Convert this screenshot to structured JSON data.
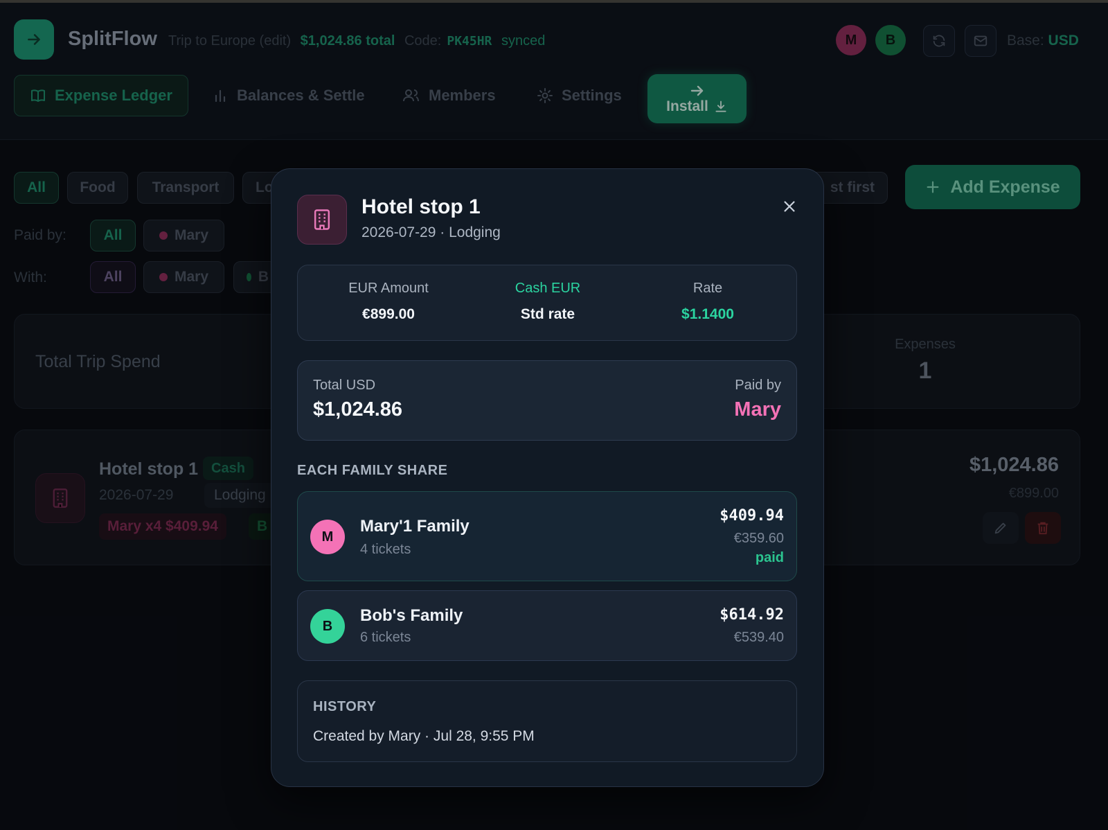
{
  "header": {
    "brand": "SplitFlow",
    "trip_name": "Trip to Europe (edit)",
    "trip_total": "$1,024.86 total",
    "code_label": "Code:",
    "code": "PK45HR",
    "sync_status": "synced",
    "avatars": [
      {
        "initial": "M",
        "color": "#ec4899"
      },
      {
        "initial": "B",
        "color": "#22c55e"
      }
    ],
    "base_label": "Base:",
    "base_currency": "USD"
  },
  "tabs": [
    {
      "label": "Expense Ledger",
      "icon": "book-icon"
    },
    {
      "label": "Balances & Settle",
      "icon": "bar-chart-icon"
    },
    {
      "label": "Members",
      "icon": "users-icon"
    },
    {
      "label": "Settings",
      "icon": "gear-icon"
    }
  ],
  "install": {
    "label": "Install"
  },
  "filters": {
    "categories": [
      "All",
      "Food",
      "Transport",
      "Lo"
    ],
    "sort_partial": "st first",
    "paid_by_label": "Paid by:",
    "paid_by": [
      "All",
      "Mary"
    ],
    "with_label": "With:",
    "with": [
      "All",
      "Mary",
      "B"
    ]
  },
  "add_expense": {
    "label": "Add Expense"
  },
  "summary": {
    "total_label": "Total Trip Spend",
    "expenses_label": "Expenses",
    "expenses_count": "1"
  },
  "bg_expense": {
    "title": "Hotel stop 1",
    "badge": "Cash",
    "date": "2026-07-29",
    "category": "Lodging",
    "share_mary": "Mary x4 $409.94",
    "share_b": "B",
    "usd": "$1,024.86",
    "eur": "€899.00"
  },
  "modal": {
    "title": "Hotel stop 1",
    "subtitle": "2026-07-29 · Lodging",
    "rates": [
      {
        "label": "EUR Amount",
        "value": "€899.00"
      },
      {
        "label": "Cash EUR",
        "value": "Std rate"
      },
      {
        "label": "Rate",
        "value": "$1.1400"
      }
    ],
    "total_label": "Total USD",
    "total_value": "$1,024.86",
    "paid_by_label": "Paid by",
    "paid_by_value": "Mary",
    "shares_title": "EACH FAMILY SHARE",
    "families": [
      {
        "initial": "M",
        "name": "Mary'1 Family",
        "tickets": "4 tickets",
        "usd": "$409.94",
        "eur": "€359.60",
        "status": "paid"
      },
      {
        "initial": "B",
        "name": "Bob's Family",
        "tickets": "6 tickets",
        "usd": "$614.92",
        "eur": "€539.40"
      }
    ],
    "history_title": "HISTORY",
    "history_entry": "Created by Mary · Jul 28, 9:55 PM"
  },
  "colors": {
    "accent": "#1f8a6a",
    "mary": "#ec4899",
    "bob": "#34d399",
    "rate": "#2bd4a0"
  }
}
